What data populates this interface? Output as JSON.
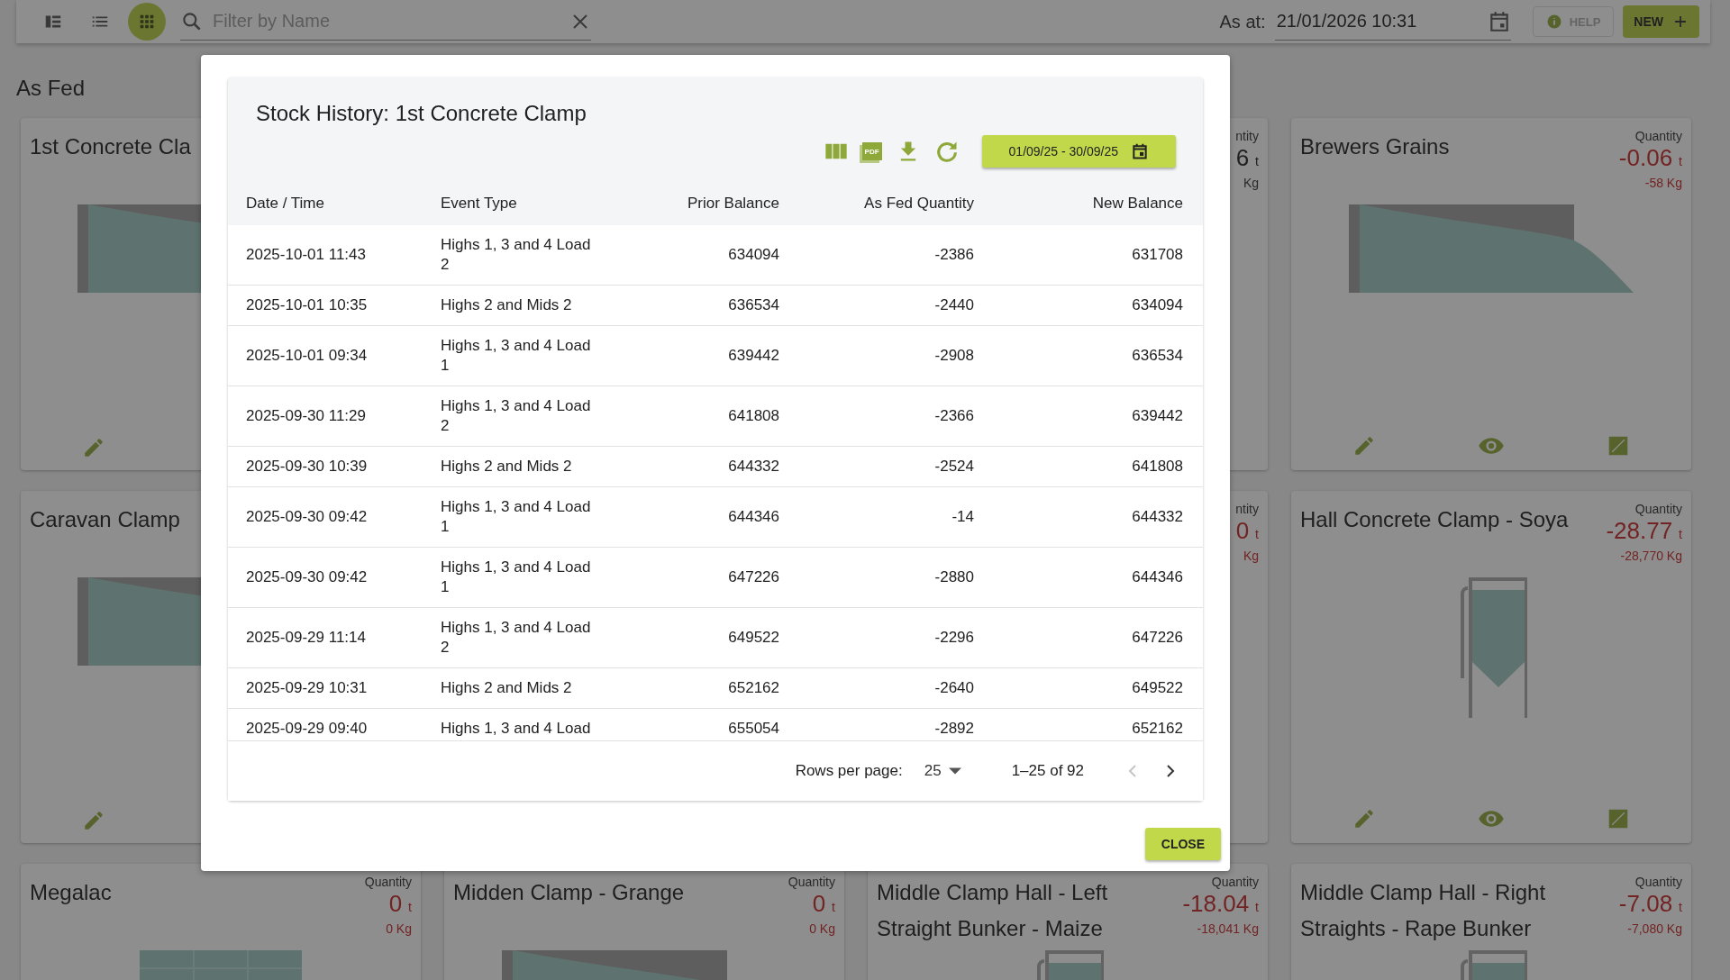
{
  "top_bar": {
    "view_modes": [
      {
        "kind": "panel",
        "selected": false
      },
      {
        "kind": "list",
        "selected": false
      },
      {
        "kind": "grid",
        "selected": true
      }
    ],
    "search": {
      "placeholder": "Filter by Name"
    },
    "as_at": {
      "label": "As at:",
      "value": "21/01/2026 10:31"
    },
    "help_button": "HELP",
    "new_button": "NEW"
  },
  "section_title": "As Fed",
  "cards": [
    {
      "title": "1st Concrete Cla",
      "picture": {
        "kind": "clamp"
      },
      "actions": [
        {
          "kind": "edit"
        }
      ]
    },
    {
      "quantity_label": "ntity",
      "quantity": "6",
      "unit": "t",
      "kg": "Kg",
      "alert": false
    },
    {
      "title": "Brewers Grains",
      "quantity_label": "Quantity",
      "quantity": "-0.06",
      "unit": "t",
      "kg": "-58 Kg",
      "alert": true,
      "picture": {
        "kind": "clamp"
      },
      "actions": [
        {
          "kind": "edit"
        },
        {
          "kind": "view"
        },
        {
          "kind": "adjust"
        }
      ]
    },
    {
      "title": "Caravan Clamp",
      "picture": {
        "kind": "clamp"
      },
      "actions": [
        {
          "kind": "edit"
        }
      ]
    },
    {
      "quantity_label": "ntity",
      "quantity": "0",
      "unit": "t",
      "kg": "Kg",
      "alert": true
    },
    {
      "title": "Hall Concrete Clamp - Soya",
      "quantity_label": "Quantity",
      "quantity": "-28.77",
      "unit": "t",
      "kg": "-28,770 Kg",
      "alert": true,
      "picture": {
        "kind": "silo"
      },
      "actions": [
        {
          "kind": "edit"
        },
        {
          "kind": "view"
        },
        {
          "kind": "adjust"
        }
      ]
    },
    {
      "title": "Megalac",
      "quantity_label": "Quantity",
      "quantity": "0",
      "unit": "t",
      "kg": "0 Kg",
      "alert": true,
      "picture": {
        "kind": "tank"
      }
    },
    {
      "title": "Midden Clamp - Grange",
      "quantity_label": "Quantity",
      "quantity": "0",
      "unit": "t",
      "kg": "0 Kg",
      "alert": true,
      "picture": {
        "kind": "clamp"
      }
    },
    {
      "title": "Middle Clamp Hall - Left Straight Bunker - Maize",
      "quantity_label": "Quantity",
      "quantity": "-18.04",
      "unit": "t",
      "kg": "-18,041 Kg",
      "alert": true,
      "picture": {
        "kind": "silo"
      }
    },
    {
      "title": "Middle Clamp Hall - Right Straights - Rape Bunker",
      "quantity_label": "Quantity",
      "quantity": "-7.08",
      "unit": "t",
      "kg": "-7,080 Kg",
      "alert": true,
      "picture": {
        "kind": "silo"
      }
    }
  ],
  "dialog": {
    "title": "Stock History: 1st Concrete Clamp",
    "toolbar": [
      {
        "kind": "columns"
      },
      {
        "kind": "pdf",
        "label": "PDF"
      },
      {
        "kind": "download"
      },
      {
        "kind": "refresh"
      }
    ],
    "date_range": "01/09/25 - 30/09/25",
    "table": {
      "columns": [
        "Date / Time",
        "Event Type",
        "Prior Balance",
        "As Fed Quantity",
        "New Balance"
      ],
      "rows": [
        [
          "2025-10-01 11:43",
          "Highs 1, 3 and 4 Load 2",
          "634094",
          "-2386",
          "631708"
        ],
        [
          "2025-10-01 10:35",
          "Highs 2 and Mids 2",
          "636534",
          "-2440",
          "634094"
        ],
        [
          "2025-10-01 09:34",
          "Highs 1, 3 and 4 Load 1",
          "639442",
          "-2908",
          "636534"
        ],
        [
          "2025-09-30 11:29",
          "Highs 1, 3 and 4 Load 2",
          "641808",
          "-2366",
          "639442"
        ],
        [
          "2025-09-30 10:39",
          "Highs 2 and Mids 2",
          "644332",
          "-2524",
          "641808"
        ],
        [
          "2025-09-30 09:42",
          "Highs 1, 3 and 4 Load 1",
          "644346",
          "-14",
          "644332"
        ],
        [
          "2025-09-30 09:42",
          "Highs 1, 3 and 4 Load 1",
          "647226",
          "-2880",
          "644346"
        ],
        [
          "2025-09-29 11:14",
          "Highs 1, 3 and 4 Load 2",
          "649522",
          "-2296",
          "647226"
        ],
        [
          "2025-09-29 10:31",
          "Highs 2 and Mids 2",
          "652162",
          "-2640",
          "649522"
        ],
        [
          "2025-09-29 09:40",
          "Highs 1, 3 and 4 Load",
          "655054",
          "-2892",
          "652162"
        ]
      ]
    },
    "pagination": {
      "rows_per_page_label": "Rows per page:",
      "rows_per_page": "25",
      "range": "1–25 of 92",
      "prev_disabled": true,
      "next_disabled": false
    },
    "close_button": "CLOSE"
  }
}
